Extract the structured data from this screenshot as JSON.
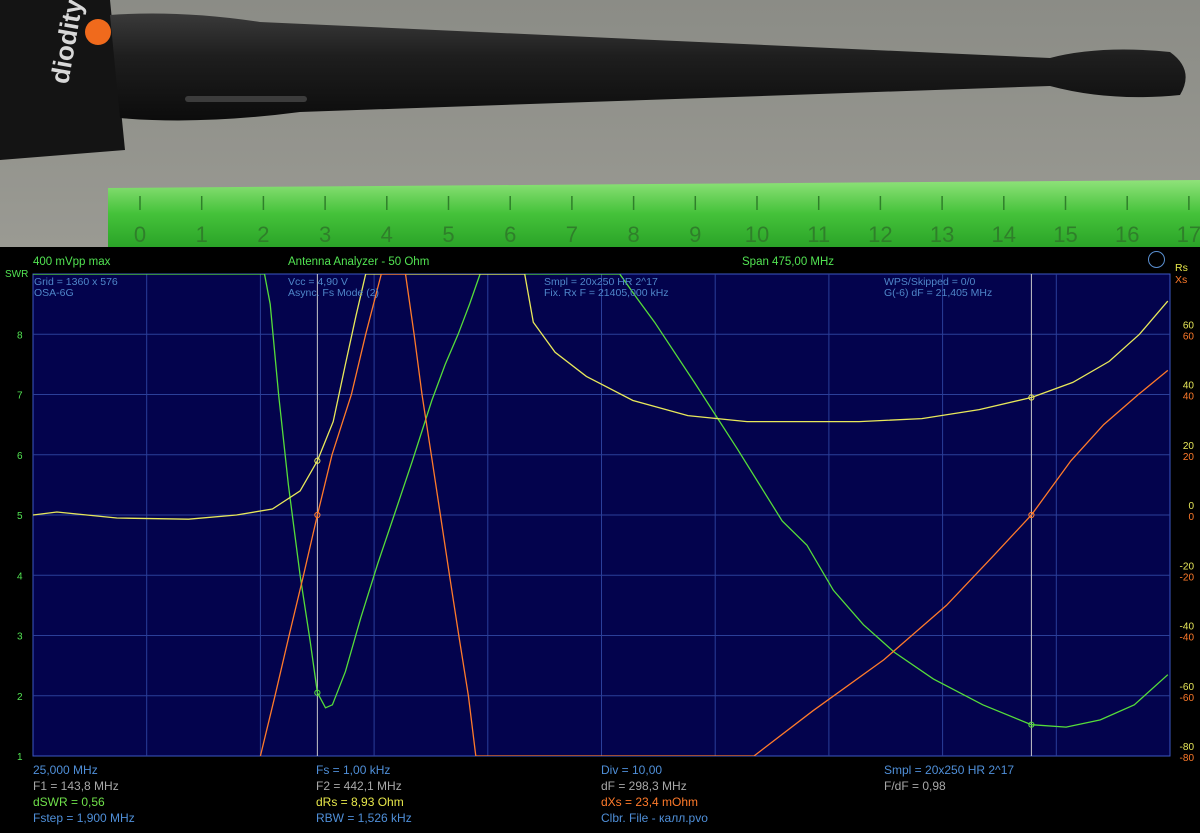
{
  "header": {
    "mode": "400 mVpp max",
    "title": "Antenna Analyzer - 50 Ohm",
    "span": "Span 475,00 MHz",
    "left_axis_name": "SWR",
    "right_axis_rs": "Rs",
    "right_axis_xs": "Xs"
  },
  "info": {
    "grid": "Grid = 1360 x 576",
    "device": "OSA-6G",
    "vcc": "Vcc = 4,90 V",
    "async": "Async. Fs Mode (2)",
    "smpl": "Smpl = 20x250 HR  2^17",
    "fix_rx": "Fix. Rx F = 21405,000 kHz",
    "wps": "WPS/Skipped  = 0/0",
    "g6": "G(-6) dF = 21,405 MHz"
  },
  "footer": {
    "start_freq": "25,000 MHz",
    "f1": "F1 = 143,8 MHz",
    "dswr": "dSWR = 0,56",
    "fstep": "Fstep = 1,900 MHz",
    "fs": "Fs = 1,00 kHz",
    "f2": "F2 = 442,1 MHz",
    "drs": "dRs = 8,93 Ohm",
    "rbw": "RBW = 1,526 kHz",
    "div": "Div = 10,00",
    "df": "dF = 298,3 MHz",
    "dxs": "dXs = 23,4 mOhm",
    "clbr": "Clbr. File - калл.pvo",
    "smpl": "Smpl = 20x250 HR  2^17",
    "f_df": "F/dF = 0,98"
  },
  "photo": {
    "ruler_numbers": [
      "0",
      "1",
      "2",
      "3",
      "4",
      "5",
      "6",
      "7",
      "8",
      "9",
      "10",
      "11",
      "12",
      "13",
      "14",
      "15",
      "16",
      "17"
    ],
    "brand_text": "diodity"
  },
  "colors": {
    "background": "#000000",
    "plot_bg": "#03034d",
    "grid": "#2b3f99",
    "swr": "#55dd3a",
    "rs": "#e8e85a",
    "xs": "#ff7a2a",
    "marker": "#c8c8c8"
  },
  "chart_data": {
    "type": "line",
    "title": "Antenna Analyzer - 50 Ohm",
    "x_start_mhz": 25.0,
    "x_span_mhz": 475.0,
    "xlim": [
      25.0,
      500.0
    ],
    "y_left": {
      "label": "SWR",
      "ylim": [
        1,
        9
      ],
      "ticks": [
        1,
        2,
        3,
        4,
        5,
        6,
        7,
        8
      ]
    },
    "y_right_rs": {
      "label": "Rs",
      "ylim": [
        -80,
        80
      ],
      "ticks": [
        60,
        40,
        20,
        0,
        -20,
        -40,
        -60,
        -80
      ]
    },
    "y_right_xs": {
      "label": "Xs",
      "ylim": [
        -80,
        80
      ],
      "ticks": [
        60,
        40,
        20,
        0,
        -20,
        -40,
        -60,
        -80
      ]
    },
    "grid": true,
    "markers": [
      {
        "name": "F1",
        "freq_mhz": 143.8
      },
      {
        "name": "F2",
        "freq_mhz": 442.1
      }
    ],
    "series": [
      {
        "name": "SWR",
        "axis": "left",
        "color": "#55dd3a",
        "points": [
          [
            25,
            9
          ],
          [
            121.7,
            9
          ],
          [
            124.1,
            8.5
          ],
          [
            127.6,
            7
          ],
          [
            131.7,
            5.5
          ],
          [
            136.6,
            4
          ],
          [
            140.8,
            2.9
          ],
          [
            143.8,
            2.05
          ],
          [
            147.2,
            1.8
          ],
          [
            150.1,
            1.85
          ],
          [
            155.5,
            2.4
          ],
          [
            162.0,
            3.3
          ],
          [
            169.1,
            4.2
          ],
          [
            175.9,
            5.0
          ],
          [
            183.5,
            5.9
          ],
          [
            191.6,
            6.9
          ],
          [
            197.2,
            7.5
          ],
          [
            202.6,
            8.0
          ],
          [
            207.4,
            8.5
          ],
          [
            211.8,
            9
          ],
          [
            270.1,
            9
          ],
          [
            277.3,
            8.6
          ],
          [
            284.7,
            8.2
          ],
          [
            301.3,
            7.2
          ],
          [
            319.2,
            6.1
          ],
          [
            338.0,
            4.9
          ],
          [
            348.3,
            4.5
          ],
          [
            359.4,
            3.75
          ],
          [
            371.9,
            3.18
          ],
          [
            384.9,
            2.72
          ],
          [
            401.1,
            2.28
          ],
          [
            421.8,
            1.85
          ],
          [
            442.1,
            1.52
          ],
          [
            456.6,
            1.48
          ],
          [
            470.9,
            1.6
          ],
          [
            485.1,
            1.85
          ],
          [
            499.1,
            2.35
          ]
        ]
      },
      {
        "name": "Rs",
        "axis": "right",
        "color": "#e8e85a",
        "points": [
          [
            25,
            5
          ],
          [
            35,
            5.05
          ],
          [
            60,
            4.95
          ],
          [
            90,
            4.93
          ],
          [
            110,
            5.0
          ],
          [
            125,
            5.1
          ],
          [
            136.6,
            5.4
          ],
          [
            143.8,
            5.9
          ],
          [
            150.4,
            6.55
          ],
          [
            155.5,
            7.5
          ],
          [
            159.9,
            8.3
          ],
          [
            164.0,
            9
          ],
          [
            230.4,
            9
          ],
          [
            234.0,
            8.2
          ],
          [
            243.1,
            7.7
          ],
          [
            256.2,
            7.3
          ],
          [
            275.6,
            6.9
          ],
          [
            298.6,
            6.65
          ],
          [
            323.3,
            6.55
          ],
          [
            350.8,
            6.55
          ],
          [
            370.1,
            6.55
          ],
          [
            396.3,
            6.6
          ],
          [
            420.3,
            6.75
          ],
          [
            442.1,
            6.95
          ],
          [
            459.4,
            7.2
          ],
          [
            474.6,
            7.55
          ],
          [
            487.2,
            8.0
          ],
          [
            499.1,
            8.55
          ]
        ],
        "note_units": "SWR-scale position"
      },
      {
        "name": "Xs",
        "axis": "right",
        "color": "#ff7a2a",
        "points": [
          [
            120.0,
            -80
          ],
          [
            126.1,
            -60
          ],
          [
            132.0,
            -40
          ],
          [
            138.0,
            -20
          ],
          [
            143.8,
            0
          ],
          [
            149.9,
            20
          ],
          [
            158.0,
            40
          ],
          [
            164.0,
            60
          ],
          [
            170.5,
            80
          ],
          [
            180.6,
            80
          ],
          [
            184.2,
            60
          ],
          [
            187.5,
            40
          ],
          [
            191.4,
            20
          ],
          [
            195.2,
            0
          ],
          [
            199.0,
            -20
          ],
          [
            202.9,
            -40
          ],
          [
            206.9,
            -60
          ],
          [
            210.0,
            -80
          ],
          [
            326.2,
            -80
          ],
          [
            350.8,
            -65
          ],
          [
            380.5,
            -48
          ],
          [
            406.6,
            -30
          ],
          [
            425.7,
            -14
          ],
          [
            442.1,
            0
          ],
          [
            458.6,
            18
          ],
          [
            472.3,
            30
          ],
          [
            486.8,
            40
          ],
          [
            499.1,
            48
          ]
        ]
      }
    ]
  }
}
